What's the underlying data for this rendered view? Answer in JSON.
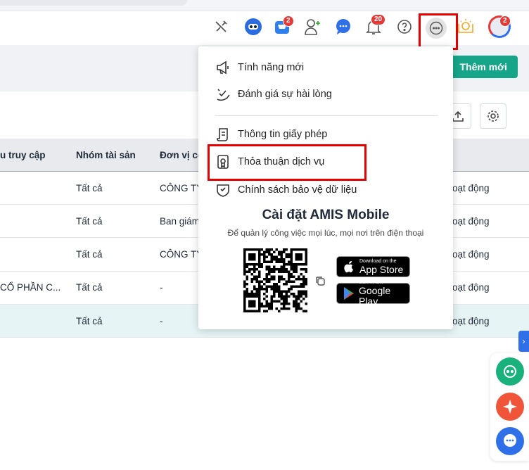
{
  "header": {
    "badges": {
      "cart": "2",
      "notifications": "20",
      "avatar": "2"
    }
  },
  "toolbar": {
    "add_label": "Thêm mới"
  },
  "table": {
    "headers": [
      "u truy cập",
      "Nhóm tài sản",
      "Đơn vị cô"
    ],
    "rows": [
      {
        "c1": "",
        "c2": "Tất cả",
        "c3": "CÔNG TY",
        "c4": "oạt động"
      },
      {
        "c1": "",
        "c2": "Tất cả",
        "c3": "Ban giám",
        "c4": "oạt động"
      },
      {
        "c1": "",
        "c2": "Tất cả",
        "c3": "CÔNG TY",
        "c4": "oạt động"
      },
      {
        "c1": "CỔ PHẦN C...",
        "c2": "Tất cả",
        "c3": "-",
        "c4": "oạt động"
      },
      {
        "c1": "",
        "c2": "Tất cả",
        "c3": "-",
        "c4": "oạt động"
      }
    ]
  },
  "menu": {
    "items": [
      "Tính năng mới",
      "Đánh giá sự hài lòng",
      "Thông tin giấy phép",
      "Thỏa thuận dịch vụ",
      "Chính sách bảo vệ dữ liệu"
    ],
    "mobile_title": "Cài đặt AMIS Mobile",
    "mobile_subtitle": "Để quản lý công việc mọi lúc, mọi nơi trên điện thoại",
    "appstore_small": "Download on the",
    "appstore_big": "App Store",
    "gplay_small": "GET IT ON",
    "gplay_big": "Google Play"
  },
  "colors": {
    "accent": "#17a589",
    "highlight": "#e60000"
  }
}
